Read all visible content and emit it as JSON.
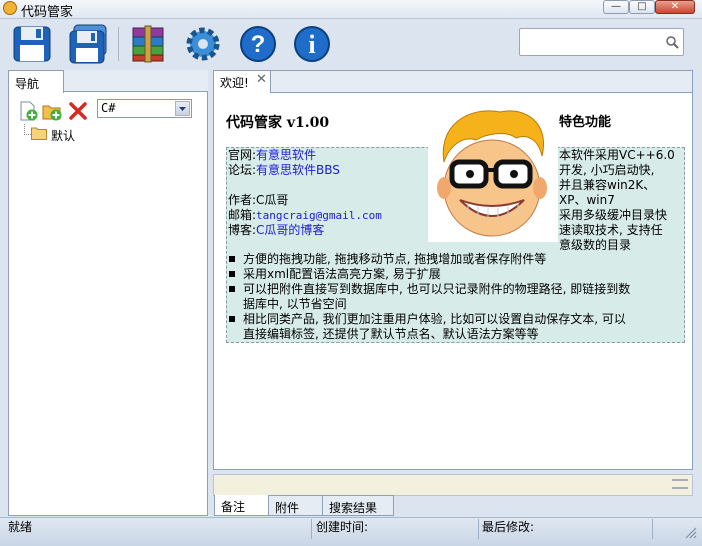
{
  "window": {
    "title": "代码管家"
  },
  "toolbar": {
    "buttons": [
      {
        "name": "save",
        "icon": "save-icon"
      },
      {
        "name": "save-all",
        "icon": "save-all-icon"
      },
      {
        "name": "archive",
        "icon": "archive-icon"
      },
      {
        "name": "settings",
        "icon": "gear-icon"
      },
      {
        "name": "help",
        "icon": "help-icon"
      },
      {
        "name": "about",
        "icon": "info-icon"
      }
    ],
    "search": {
      "value": "",
      "placeholder": ""
    }
  },
  "nav": {
    "tab_label": "导航",
    "language_select": "C#",
    "tree": [
      {
        "label": "默认"
      }
    ]
  },
  "content": {
    "tab_label": "欢迎!",
    "title": "代码管家  v1.00",
    "features_title": "特色功能",
    "info": {
      "website_label": "官网:",
      "website_link": "有意思软件",
      "forum_label": "论坛:",
      "forum_link": "有意思软件BBS",
      "author_label": "作者:",
      "author_value": "C瓜哥",
      "email_label": "邮箱:",
      "email_value": "tangcraig@gmail.com",
      "blog_label": "博客:",
      "blog_link": "C瓜哥的博客"
    },
    "features": [
      "本软件采用VC++6.0",
      "开发, 小巧启动快,",
      "并且兼容win2K、",
      "XP、win7",
      "采用多级缓冲目录快",
      "速读取技术, 支持任",
      "意级数的目录"
    ],
    "bullets": [
      [
        "方便的拖拽功能, 拖拽移动节点, 拖拽增加或者保存附件等"
      ],
      [
        "采用xml配置语法高亮方案, 易于扩展"
      ],
      [
        "可以把附件直接写到数据库中, 也可以只记录附件的物理路径, 即链接到数",
        "据库中, 以节省空间"
      ],
      [
        "相比同类产品, 我们更加注重用户体验, 比如可以设置自动保存文本, 可以",
        "直接编辑标签, 还提供了默认节点名、默认语法方案等等"
      ]
    ]
  },
  "bottom_tabs": [
    "备注",
    "附件",
    "搜索结果"
  ],
  "status": {
    "ready": "就绪",
    "created_label": "创建时间:",
    "modified_label": "最后修改:"
  },
  "colors": {
    "info_bg": "#d7ebe8",
    "link": "#1b1bd6",
    "chrome": "#dbe4ef"
  }
}
